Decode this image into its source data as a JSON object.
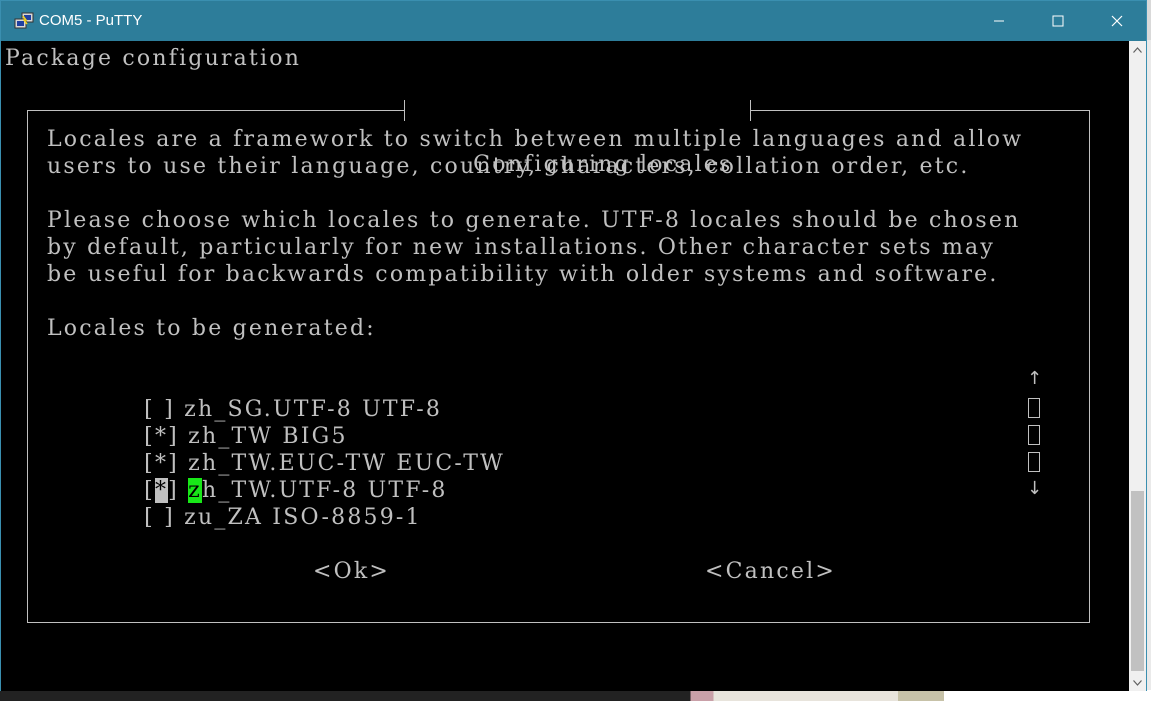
{
  "window": {
    "title": "COM5 - PuTTY",
    "controls": {
      "minimize": "—",
      "maximize": "☐",
      "close": "✕"
    }
  },
  "terminal": {
    "header": "Package configuration",
    "dialog_title": "Configuring locales",
    "paragraph1": [
      "Locales are a framework to switch between multiple languages and allow",
      "users to use their language, country, characters, collation order, etc."
    ],
    "paragraph2": [
      "Please choose which locales to generate. UTF-8 locales should be chosen",
      "by default, particularly for new installations. Other character sets may",
      "be useful for backwards compatibility with older systems and software."
    ],
    "list_label": "Locales to be generated:",
    "locales": [
      {
        "checkbox_open": "[",
        "mark": " ",
        "checkbox_close": "]",
        "label": "zh_SG.UTF-8 UTF-8"
      },
      {
        "checkbox_open": "[",
        "mark": "*",
        "checkbox_close": "]",
        "label": "zh_TW BIG5"
      },
      {
        "checkbox_open": "[",
        "mark": "*",
        "checkbox_close": "]",
        "label": "zh_TW.EUC-TW EUC-TW"
      },
      {
        "checkbox_open": "[",
        "mark": "*",
        "checkbox_close": "]",
        "label_first": "z",
        "label_rest": "h_TW.UTF-8 UTF-8"
      },
      {
        "checkbox_open": "[",
        "mark": " ",
        "checkbox_close": "]",
        "label": "zu_ZA ISO-8859-1"
      }
    ],
    "scroll_arrow_up": "↑",
    "scroll_arrow_down": "↓",
    "ok_button": "<Ok>",
    "cancel_button": "<Cancel>"
  },
  "colors": {
    "titlebar": "#2d7d9a",
    "terminal_bg": "#000000",
    "terminal_fg": "#c0c0c0",
    "cursor": "#18e818"
  },
  "icons": {
    "app": "putty-icon",
    "scroll_up": "scroll-up-arrow-icon",
    "scroll_down": "scroll-down-arrow-icon"
  }
}
